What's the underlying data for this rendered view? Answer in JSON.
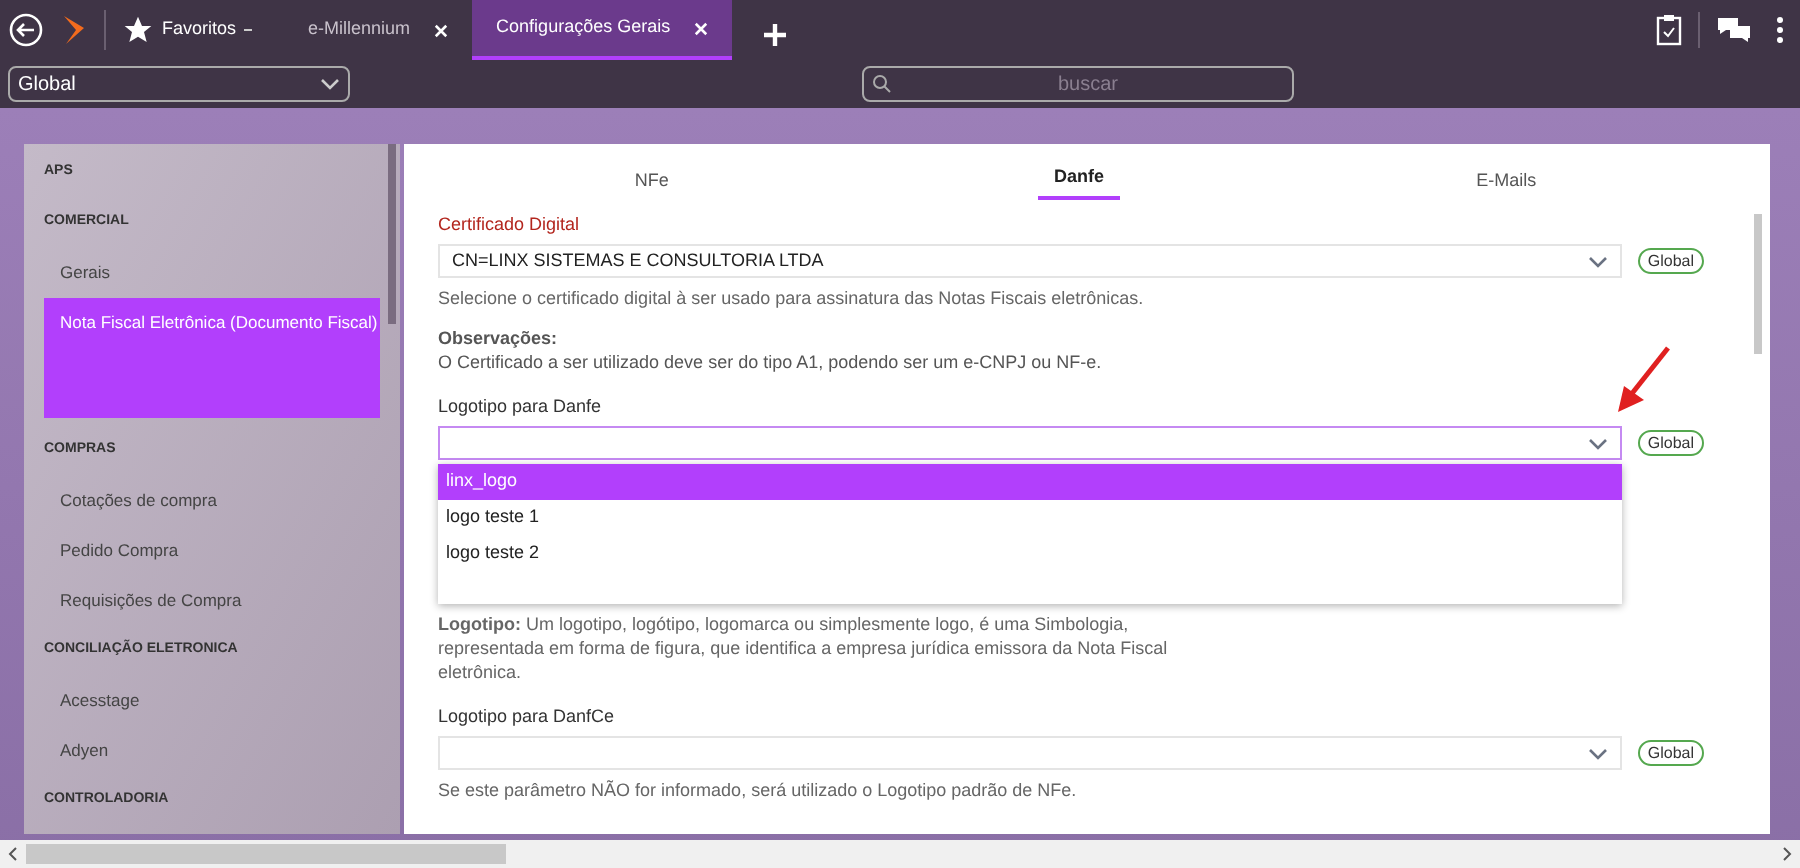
{
  "top_bar": {
    "favorites": "Favoritos",
    "tabs": [
      {
        "label": "e-Millennium",
        "selected": false
      },
      {
        "label": "Configurações Gerais",
        "selected": true
      }
    ]
  },
  "toolbar": {
    "scope": "Global",
    "search": {
      "placeholder": "buscar"
    }
  },
  "sidebar": {
    "sections": [
      {
        "title": "APS"
      },
      {
        "title": "COMERCIAL",
        "items": [
          {
            "label": "Gerais",
            "selected": false
          },
          {
            "label": "Nota Fiscal Eletrônica (Documento Fiscal)",
            "selected": true
          }
        ]
      },
      {
        "title": "COMPRAS",
        "items": [
          {
            "label": "Cotações de compra",
            "selected": false
          },
          {
            "label": "Pedido Compra",
            "selected": false
          },
          {
            "label": "Requisições de Compra",
            "selected": false
          }
        ]
      },
      {
        "title": "CONCILIAÇÃO ELETRONICA",
        "items": [
          {
            "label": "Acesstage",
            "selected": false
          },
          {
            "label": "Adyen",
            "selected": false
          }
        ]
      },
      {
        "title": "CONTROLADORIA"
      }
    ]
  },
  "content": {
    "tabs": [
      {
        "label": "NFe",
        "selected": false
      },
      {
        "label": "Danfe",
        "selected": true
      },
      {
        "label": "E-Mails",
        "selected": false
      }
    ],
    "fields": [
      {
        "kind": "select",
        "label": "Certificado Digital",
        "required": true,
        "value": "CN=LINX SISTEMAS E CONSULTORIA LTDA",
        "badge": "Global",
        "open": false,
        "hint": "Selecione o certificado digital à ser usado para assinatura das Notas Fiscais eletrônicas."
      },
      {
        "kind": "note",
        "title": "Observações:",
        "text": "O Certificado a ser utilizado deve ser do tipo A1, podendo ser um e-CNPJ ou NF-e."
      },
      {
        "kind": "select",
        "label": "Logotipo para Danfe",
        "required": false,
        "badge": "Global",
        "open": true,
        "options": [
          {
            "label": "linx_logo",
            "selected": true
          },
          {
            "label": "logo teste 1",
            "selected": false
          },
          {
            "label": "logo teste 2",
            "selected": false
          }
        ],
        "hint": "**Logotipo:** Um logotipo, logótipo, logomarca ou simplesmente logo, é uma Simbologia, representada em forma de figura, que identifica a empresa jurídica emissora da Nota Fiscal eletrônica."
      },
      {
        "kind": "select",
        "label": "Logotipo para DanfCe",
        "required": false,
        "badge": "Global",
        "open": false,
        "hint": "Se este parâmetro NÃO for informado, será utilizado o Logotipo padrão de NFe."
      }
    ]
  }
}
